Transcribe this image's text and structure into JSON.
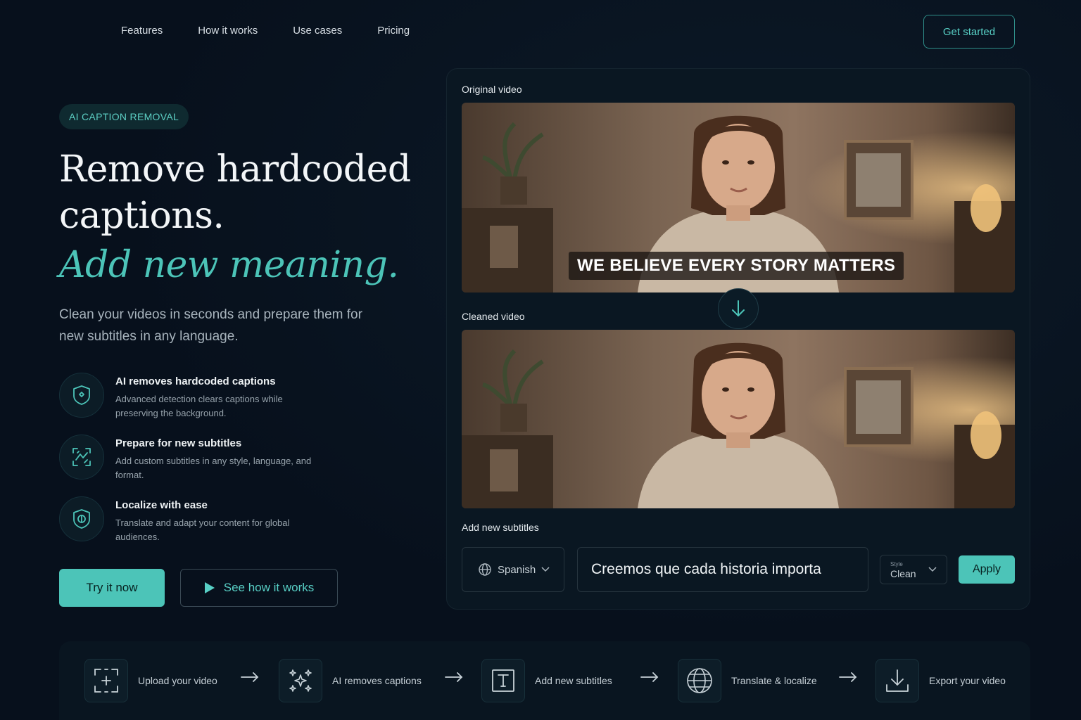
{
  "nav": {
    "items": [
      "Features",
      "How it works",
      "Use cases",
      "Pricing"
    ],
    "cta_label": "Get started"
  },
  "hero": {
    "badge": "AI CAPTION REMOVAL",
    "title_line1": "Remove hardcoded",
    "title_line2": "captions.",
    "accent": "Add new meaning.",
    "subtitle": "Clean your videos in seconds and prepare them for new subtitles in any language."
  },
  "features": [
    {
      "icon": "shield-icon",
      "title": "AI removes hardcoded captions",
      "desc": "Advanced detection clears captions while preserving the background."
    },
    {
      "icon": "subtitles-transform-icon",
      "title": "Prepare for new subtitles",
      "desc": "Add custom subtitles in any style, language, and format."
    },
    {
      "icon": "shield-globe-icon",
      "title": "Localize with ease",
      "desc": "Translate and adapt your content for global audiences."
    }
  ],
  "buttons": {
    "try_label": "Try it now",
    "see_label": "See how it works"
  },
  "panel": {
    "original_label": "Original video",
    "original_caption": "WE BELIEVE EVERY STORY MATTERS",
    "cleaned_label": "Cleaned video",
    "subtitles_label": "Add new subtitles",
    "language": "Spanish",
    "subtitle_text": "Creemos que cada historia importa",
    "style_small": "Style",
    "style_value": "Clean",
    "apply_label": "Apply"
  },
  "steps": [
    {
      "icon": "upload-frame-icon",
      "label": "Upload your video"
    },
    {
      "icon": "sparkles-icon",
      "label": "AI removes captions"
    },
    {
      "icon": "text-box-icon",
      "label": "Add new subtitles"
    },
    {
      "icon": "globe-icon",
      "label": "Translate & localize"
    },
    {
      "icon": "download-icon",
      "label": "Export your video"
    }
  ],
  "colors": {
    "background": "#07101c",
    "accent": "#4cc4b8",
    "panel": "#0a1722"
  }
}
